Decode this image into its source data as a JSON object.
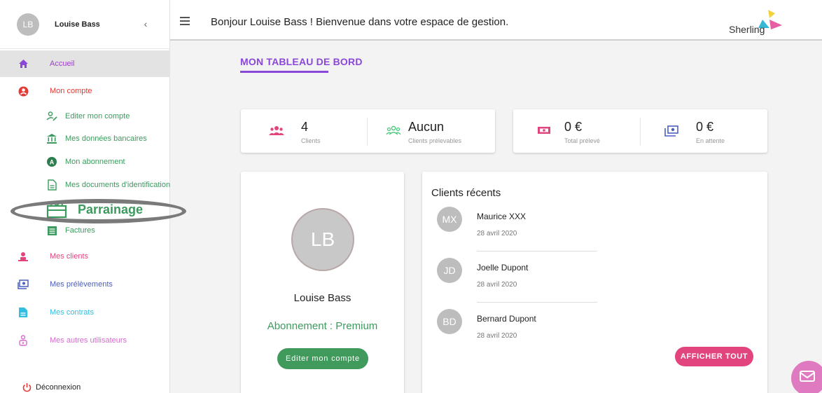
{
  "user": {
    "initials": "LB",
    "name": "Louise Bass"
  },
  "sidebar": {
    "items": [
      {
        "label": "Accueil",
        "color": "#9b3fcb"
      },
      {
        "label": "Mon compte",
        "color": "#e53935"
      },
      {
        "label": "Mes clients",
        "color": "#e2447e"
      },
      {
        "label": "Mes prélèvements",
        "color": "#4a5fc1"
      },
      {
        "label": "Mes contrats",
        "color": "#33bde0"
      },
      {
        "label": "Mes autres utilisateurs",
        "color": "#d66bd0"
      }
    ],
    "account_subitems": [
      {
        "label": "Editer mon compte"
      },
      {
        "label": "Mes données bancaires"
      },
      {
        "label": "Mon abonnement"
      },
      {
        "label": "Mes documents d'identification"
      },
      {
        "label": "Parrainage"
      },
      {
        "label": "Factures"
      }
    ],
    "logout": "Déconnexion"
  },
  "topbar": {
    "welcome": "Bonjour Louise Bass ! Bienvenue dans votre espace de gestion.",
    "logo_text": "Sherling"
  },
  "dashboard": {
    "title": "MON TABLEAU DE BORD",
    "stats": [
      {
        "value": "4",
        "label": "Clients"
      },
      {
        "value": "Aucun",
        "label": "Clients prélevables"
      },
      {
        "value": "0 €",
        "label": "Total prélevé"
      },
      {
        "value": "0 €",
        "label": "En attente"
      }
    ],
    "profile": {
      "initials": "LB",
      "name": "Louise Bass",
      "subscription": "Abonnement : Premium",
      "edit_button": "Editer mon compte"
    },
    "recent_clients": {
      "title": "Clients récents",
      "items": [
        {
          "initials": "MX",
          "name": "Maurice XXX",
          "date": "28 avril 2020"
        },
        {
          "initials": "JD",
          "name": "Joelle Dupont",
          "date": "28 avril 2020"
        },
        {
          "initials": "BD",
          "name": "Bernard Dupont",
          "date": "28 avril 2020"
        }
      ],
      "show_all": "AFFICHER TOUT"
    }
  }
}
